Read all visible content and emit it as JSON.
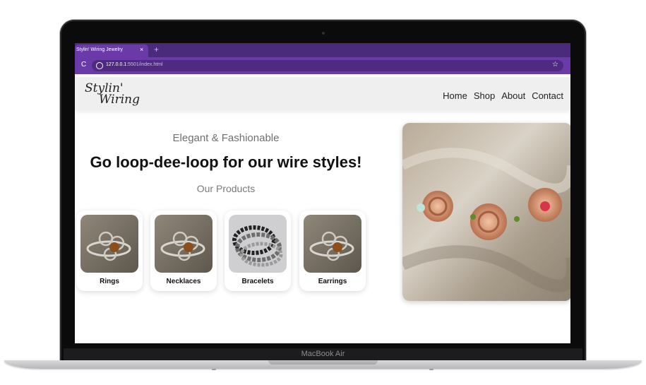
{
  "browser": {
    "tab_title": "Stylin' Wiring Jewelry",
    "tab_close": "×",
    "new_tab": "+",
    "reload": "C",
    "url_host": "127.0.0.1",
    "url_path": ":5501/index.html",
    "bookmark_star": "☆"
  },
  "site": {
    "logo_line1": "Stylin'",
    "logo_line2": "Wiring",
    "nav": [
      "Home",
      "Shop",
      "About",
      "Contact"
    ]
  },
  "hero": {
    "tagline": "Elegant & Fashionable",
    "headline": "Go loop-dee-loop for our wire styles!",
    "products_heading": "Our Products"
  },
  "products": [
    {
      "label": "Rings"
    },
    {
      "label": "Necklaces"
    },
    {
      "label": "Bracelets"
    },
    {
      "label": "Earrings"
    }
  ],
  "device": {
    "label": "MacBook Air"
  },
  "colors": {
    "tabbar": "#4a2a7a",
    "addressbar": "#6a3aa8",
    "header_bg": "#efefef"
  }
}
